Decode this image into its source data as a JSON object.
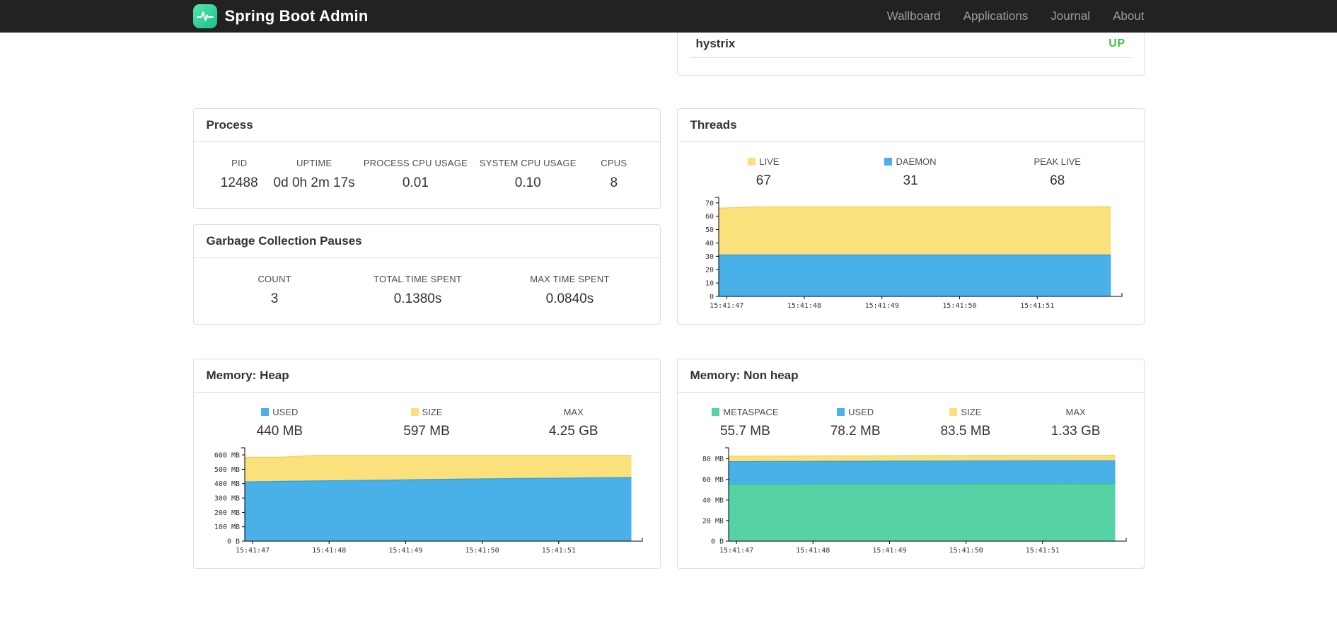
{
  "navbar": {
    "brand": "Spring Boot Admin",
    "links": [
      {
        "label": "Wallboard"
      },
      {
        "label": "Applications"
      },
      {
        "label": "Journal"
      },
      {
        "label": "About"
      }
    ]
  },
  "colors": {
    "status_up": "#42c142",
    "chart_blue": "#4ab1e8",
    "chart_yellow": "#fbe17b",
    "chart_green": "#55d3a5"
  },
  "health": {
    "rows": [
      {
        "name": "hystrix",
        "status": "UP"
      }
    ]
  },
  "process": {
    "title": "Process",
    "metrics": [
      {
        "label": "PID",
        "value": "12488"
      },
      {
        "label": "UPTIME",
        "value": "0d 0h 2m 17s"
      },
      {
        "label": "PROCESS CPU USAGE",
        "value": "0.01"
      },
      {
        "label": "SYSTEM CPU USAGE",
        "value": "0.10"
      },
      {
        "label": "CPUS",
        "value": "8"
      }
    ]
  },
  "gc": {
    "title": "Garbage Collection Pauses",
    "metrics": [
      {
        "label": "COUNT",
        "value": "3"
      },
      {
        "label": "TOTAL TIME SPENT",
        "value": "0.1380s"
      },
      {
        "label": "MAX TIME SPENT",
        "value": "0.0840s"
      }
    ]
  },
  "threads": {
    "title": "Threads",
    "legend": [
      {
        "label": "LIVE",
        "value": "67",
        "color": "#fbe17b"
      },
      {
        "label": "DAEMON",
        "value": "31",
        "color": "#4ab1e8"
      },
      {
        "label": "PEAK LIVE",
        "value": "68"
      }
    ]
  },
  "memory_heap": {
    "title": "Memory: Heap",
    "legend": [
      {
        "label": "USED",
        "value": "440 MB",
        "color": "#4ab1e8"
      },
      {
        "label": "SIZE",
        "value": "597 MB",
        "color": "#fbe17b"
      },
      {
        "label": "MAX",
        "value": "4.25 GB"
      }
    ]
  },
  "memory_nonheap": {
    "title": "Memory: Non heap",
    "legend": [
      {
        "label": "METASPACE",
        "value": "55.7 MB",
        "color": "#55d3a5"
      },
      {
        "label": "USED",
        "value": "78.2 MB",
        "color": "#4ab1e8"
      },
      {
        "label": "SIZE",
        "value": "83.5 MB",
        "color": "#fbe17b"
      },
      {
        "label": "MAX",
        "value": "1.33 GB"
      }
    ]
  },
  "chart_data": [
    {
      "id": "threads-chart",
      "type": "area",
      "title": "Threads",
      "x_labels": [
        "15:41:47",
        "15:41:48",
        "15:41:49",
        "15:41:50",
        "15:41:51"
      ],
      "ylim": [
        0,
        72
      ],
      "yticks": [
        {
          "v": 0,
          "label": "0"
        },
        {
          "v": 10,
          "label": "10"
        },
        {
          "v": 20,
          "label": "20"
        },
        {
          "v": 30,
          "label": "30"
        },
        {
          "v": 40,
          "label": "40"
        },
        {
          "v": 50,
          "label": "50"
        },
        {
          "v": 60,
          "label": "60"
        },
        {
          "v": 70,
          "label": "70"
        }
      ],
      "layers": [
        {
          "name": "LIVE",
          "color": "#fbe17b",
          "line": "#f3cf58",
          "values": [
            66,
            67,
            67,
            67,
            67,
            67,
            67,
            67,
            67,
            67,
            67,
            67
          ]
        },
        {
          "name": "DAEMON",
          "color": "#4ab1e8",
          "line": "#2d9de0",
          "values": [
            31,
            31,
            31,
            31,
            31,
            31,
            31,
            31,
            31,
            31,
            31,
            31
          ]
        }
      ]
    },
    {
      "id": "heap-chart",
      "type": "area",
      "title": "Memory: Heap",
      "unit": "MB",
      "x_labels": [
        "15:41:47",
        "15:41:48",
        "15:41:49",
        "15:41:50",
        "15:41:51"
      ],
      "ylim": [
        0,
        630
      ],
      "yticks": [
        {
          "v": 0,
          "label": "0 B"
        },
        {
          "v": 100,
          "label": "100 MB"
        },
        {
          "v": 200,
          "label": "200 MB"
        },
        {
          "v": 300,
          "label": "300 MB"
        },
        {
          "v": 400,
          "label": "400 MB"
        },
        {
          "v": 500,
          "label": "500 MB"
        },
        {
          "v": 600,
          "label": "600 MB"
        }
      ],
      "layers": [
        {
          "name": "SIZE",
          "color": "#fbe17b",
          "line": "#f3cf58",
          "values": [
            584,
            584,
            597,
            597,
            597,
            597,
            597,
            597,
            597,
            597,
            597,
            597
          ]
        },
        {
          "name": "USED",
          "color": "#4ab1e8",
          "line": "#2d9de0",
          "values": [
            413,
            416,
            419,
            422,
            425,
            428,
            431,
            434,
            436,
            438,
            441,
            443
          ]
        }
      ]
    },
    {
      "id": "nonheap-chart",
      "type": "area",
      "title": "Memory: Non heap",
      "unit": "MB",
      "x_labels": [
        "15:41:47",
        "15:41:48",
        "15:41:49",
        "15:41:50",
        "15:41:51"
      ],
      "ylim": [
        0,
        88
      ],
      "yticks": [
        {
          "v": 0,
          "label": "0 B"
        },
        {
          "v": 20,
          "label": "20 MB"
        },
        {
          "v": 40,
          "label": "40 MB"
        },
        {
          "v": 60,
          "label": "60 MB"
        },
        {
          "v": 80,
          "label": "80 MB"
        }
      ],
      "layers": [
        {
          "name": "SIZE",
          "color": "#fbe17b",
          "line": "#f3cf58",
          "values": [
            82.6,
            82.7,
            82.8,
            82.9,
            83.0,
            83.1,
            83.2,
            83.3,
            83.3,
            83.4,
            83.4,
            83.5
          ]
        },
        {
          "name": "USED",
          "color": "#4ab1e8",
          "line": "#2d9de0",
          "values": [
            77.3,
            77.4,
            77.5,
            77.6,
            77.7,
            77.8,
            77.9,
            78.0,
            78.0,
            78.1,
            78.1,
            78.2
          ]
        },
        {
          "name": "METASPACE",
          "color": "#55d3a5",
          "line": "#35c48f",
          "values": [
            55.2,
            55.3,
            55.3,
            55.4,
            55.4,
            55.5,
            55.5,
            55.6,
            55.6,
            55.6,
            55.7,
            55.7
          ]
        }
      ]
    }
  ]
}
